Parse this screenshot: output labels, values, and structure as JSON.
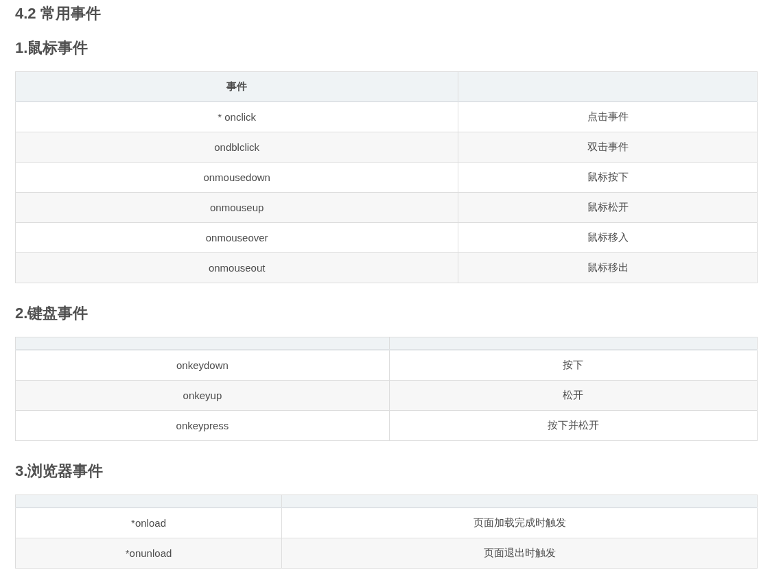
{
  "heading": "4.2 常用事件",
  "sections": [
    {
      "title": "1.鼠标事件",
      "table": {
        "header_labels": [
          "事件"
        ],
        "rows": [
          {
            "event": "* onclick",
            "description": "点击事件"
          },
          {
            "event": "ondblclick",
            "description": "双击事件"
          },
          {
            "event": "onmousedown",
            "description": "鼠标按下"
          },
          {
            "event": "onmouseup",
            "description": "鼠标松开"
          },
          {
            "event": "onmouseover",
            "description": "鼠标移入"
          },
          {
            "event": "onmouseout",
            "description": "鼠标移出"
          }
        ]
      }
    },
    {
      "title": "2.键盘事件",
      "table": {
        "rows": [
          {
            "event": "onkeydown",
            "description": "按下"
          },
          {
            "event": "onkeyup",
            "description": "松开"
          },
          {
            "event": "onkeypress",
            "description": "按下并松开"
          }
        ]
      }
    },
    {
      "title": "3.浏览器事件",
      "table": {
        "rows": [
          {
            "event": "*onload",
            "description": "页面加载完成时触发"
          },
          {
            "event": "*onunload",
            "description": "页面退出时触发"
          }
        ]
      }
    }
  ]
}
